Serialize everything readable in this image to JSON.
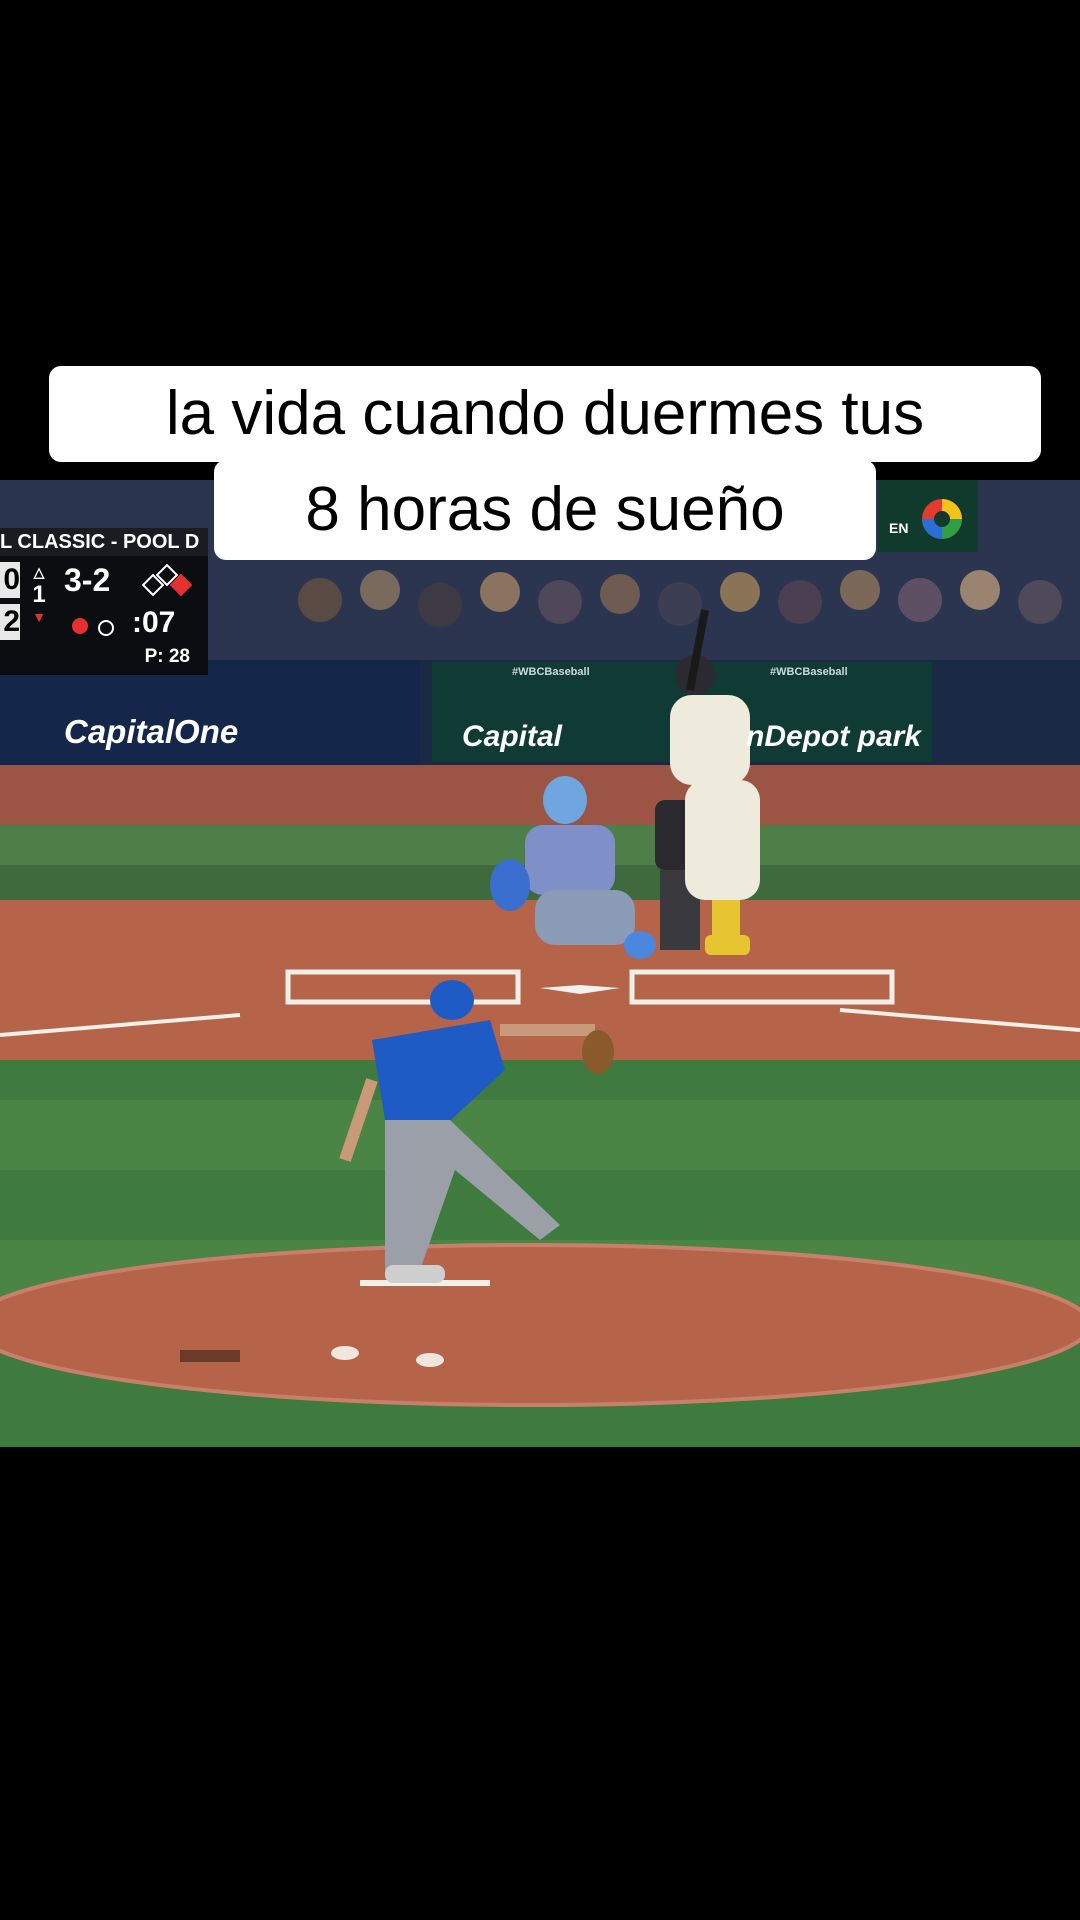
{
  "caption": {
    "line1": "la vida cuando duermes tus",
    "line2": "8 horas de sueño"
  },
  "scorebug": {
    "header": "L CLASSIC - POOL D",
    "score_top": "0",
    "score_bottom": "2",
    "inning": "1",
    "count": "3-2",
    "clock": ":07",
    "pitch_count": "P: 28"
  },
  "broadcast_logo": {
    "label": "EN"
  },
  "stadium_ads": {
    "left_ad": "CapitalOne",
    "center_ad": "Capital",
    "right_ad": "nDepot park",
    "wall_tag_left": "#WBCBaseball",
    "wall_tag_right": "#WBCBaseball"
  },
  "colors": {
    "background": "#000000",
    "caption_bg": "#ffffff",
    "grass": "#3f7a3e",
    "dirt": "#b5644a",
    "pitcher_jersey": "#1f5bc4"
  }
}
